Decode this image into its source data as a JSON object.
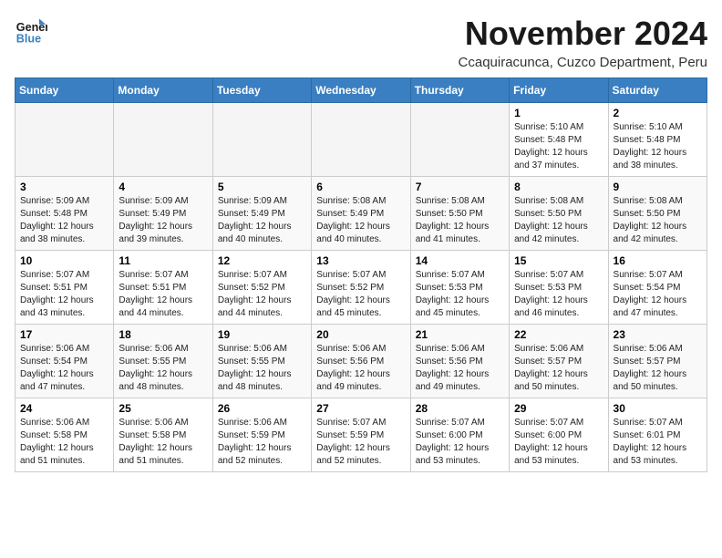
{
  "logo": {
    "line1": "General",
    "line2": "Blue"
  },
  "title": "November 2024",
  "location": "Ccaquiracunca, Cuzco Department, Peru",
  "weekdays": [
    "Sunday",
    "Monday",
    "Tuesday",
    "Wednesday",
    "Thursday",
    "Friday",
    "Saturday"
  ],
  "weeks": [
    [
      {
        "day": "",
        "detail": ""
      },
      {
        "day": "",
        "detail": ""
      },
      {
        "day": "",
        "detail": ""
      },
      {
        "day": "",
        "detail": ""
      },
      {
        "day": "",
        "detail": ""
      },
      {
        "day": "1",
        "detail": "Sunrise: 5:10 AM\nSunset: 5:48 PM\nDaylight: 12 hours\nand 37 minutes."
      },
      {
        "day": "2",
        "detail": "Sunrise: 5:10 AM\nSunset: 5:48 PM\nDaylight: 12 hours\nand 38 minutes."
      }
    ],
    [
      {
        "day": "3",
        "detail": "Sunrise: 5:09 AM\nSunset: 5:48 PM\nDaylight: 12 hours\nand 38 minutes."
      },
      {
        "day": "4",
        "detail": "Sunrise: 5:09 AM\nSunset: 5:49 PM\nDaylight: 12 hours\nand 39 minutes."
      },
      {
        "day": "5",
        "detail": "Sunrise: 5:09 AM\nSunset: 5:49 PM\nDaylight: 12 hours\nand 40 minutes."
      },
      {
        "day": "6",
        "detail": "Sunrise: 5:08 AM\nSunset: 5:49 PM\nDaylight: 12 hours\nand 40 minutes."
      },
      {
        "day": "7",
        "detail": "Sunrise: 5:08 AM\nSunset: 5:50 PM\nDaylight: 12 hours\nand 41 minutes."
      },
      {
        "day": "8",
        "detail": "Sunrise: 5:08 AM\nSunset: 5:50 PM\nDaylight: 12 hours\nand 42 minutes."
      },
      {
        "day": "9",
        "detail": "Sunrise: 5:08 AM\nSunset: 5:50 PM\nDaylight: 12 hours\nand 42 minutes."
      }
    ],
    [
      {
        "day": "10",
        "detail": "Sunrise: 5:07 AM\nSunset: 5:51 PM\nDaylight: 12 hours\nand 43 minutes."
      },
      {
        "day": "11",
        "detail": "Sunrise: 5:07 AM\nSunset: 5:51 PM\nDaylight: 12 hours\nand 44 minutes."
      },
      {
        "day": "12",
        "detail": "Sunrise: 5:07 AM\nSunset: 5:52 PM\nDaylight: 12 hours\nand 44 minutes."
      },
      {
        "day": "13",
        "detail": "Sunrise: 5:07 AM\nSunset: 5:52 PM\nDaylight: 12 hours\nand 45 minutes."
      },
      {
        "day": "14",
        "detail": "Sunrise: 5:07 AM\nSunset: 5:53 PM\nDaylight: 12 hours\nand 45 minutes."
      },
      {
        "day": "15",
        "detail": "Sunrise: 5:07 AM\nSunset: 5:53 PM\nDaylight: 12 hours\nand 46 minutes."
      },
      {
        "day": "16",
        "detail": "Sunrise: 5:07 AM\nSunset: 5:54 PM\nDaylight: 12 hours\nand 47 minutes."
      }
    ],
    [
      {
        "day": "17",
        "detail": "Sunrise: 5:06 AM\nSunset: 5:54 PM\nDaylight: 12 hours\nand 47 minutes."
      },
      {
        "day": "18",
        "detail": "Sunrise: 5:06 AM\nSunset: 5:55 PM\nDaylight: 12 hours\nand 48 minutes."
      },
      {
        "day": "19",
        "detail": "Sunrise: 5:06 AM\nSunset: 5:55 PM\nDaylight: 12 hours\nand 48 minutes."
      },
      {
        "day": "20",
        "detail": "Sunrise: 5:06 AM\nSunset: 5:56 PM\nDaylight: 12 hours\nand 49 minutes."
      },
      {
        "day": "21",
        "detail": "Sunrise: 5:06 AM\nSunset: 5:56 PM\nDaylight: 12 hours\nand 49 minutes."
      },
      {
        "day": "22",
        "detail": "Sunrise: 5:06 AM\nSunset: 5:57 PM\nDaylight: 12 hours\nand 50 minutes."
      },
      {
        "day": "23",
        "detail": "Sunrise: 5:06 AM\nSunset: 5:57 PM\nDaylight: 12 hours\nand 50 minutes."
      }
    ],
    [
      {
        "day": "24",
        "detail": "Sunrise: 5:06 AM\nSunset: 5:58 PM\nDaylight: 12 hours\nand 51 minutes."
      },
      {
        "day": "25",
        "detail": "Sunrise: 5:06 AM\nSunset: 5:58 PM\nDaylight: 12 hours\nand 51 minutes."
      },
      {
        "day": "26",
        "detail": "Sunrise: 5:06 AM\nSunset: 5:59 PM\nDaylight: 12 hours\nand 52 minutes."
      },
      {
        "day": "27",
        "detail": "Sunrise: 5:07 AM\nSunset: 5:59 PM\nDaylight: 12 hours\nand 52 minutes."
      },
      {
        "day": "28",
        "detail": "Sunrise: 5:07 AM\nSunset: 6:00 PM\nDaylight: 12 hours\nand 53 minutes."
      },
      {
        "day": "29",
        "detail": "Sunrise: 5:07 AM\nSunset: 6:00 PM\nDaylight: 12 hours\nand 53 minutes."
      },
      {
        "day": "30",
        "detail": "Sunrise: 5:07 AM\nSunset: 6:01 PM\nDaylight: 12 hours\nand 53 minutes."
      }
    ]
  ]
}
